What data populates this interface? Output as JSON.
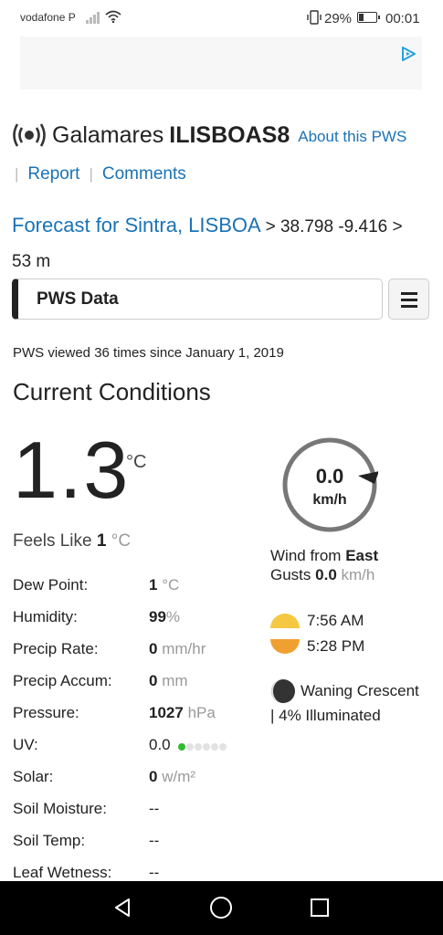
{
  "status_bar": {
    "carrier": "vodafone P",
    "battery_percent": "29%",
    "battery_level": 0.29,
    "time": "00:01"
  },
  "ad": {
    "icon": "adchoices-play-icon"
  },
  "header": {
    "station_name": "Galamares",
    "station_id": "ILISBOAS8",
    "about_link": "About this PWS",
    "icon": "broadcast-icon"
  },
  "links": {
    "report": "Report",
    "comments": "Comments",
    "separator": "|"
  },
  "forecast": {
    "link": "Forecast for Sintra, LISBOA",
    "coords": "> 38.798 -9.416 >",
    "elevation": "53 m"
  },
  "pws_bar": {
    "label": "PWS Data",
    "menu_icon": "hamburger-menu-icon"
  },
  "views_text": "PWS viewed 36 times since January 1, 2019",
  "current": {
    "title": "Current Conditions",
    "temperature": "1.3",
    "temp_unit": "°C",
    "feels_like_label": "Feels Like",
    "feels_like_value": "1",
    "feels_like_unit": "°C"
  },
  "conditions": [
    {
      "label": "Dew Point:",
      "value": "1",
      "unit": "°C"
    },
    {
      "label": "Humidity:",
      "value": "99",
      "unit": "%"
    },
    {
      "label": "Precip Rate:",
      "value": "0",
      "unit": "mm/hr"
    },
    {
      "label": "Precip Accum:",
      "value": "0",
      "unit": "mm"
    },
    {
      "label": "Pressure:",
      "value": "1027",
      "unit": "hPa"
    },
    {
      "label": "UV:",
      "value": "0.0",
      "unit": ""
    },
    {
      "label": "Solar:",
      "value": "0",
      "unit": "w/m²"
    },
    {
      "label": "Soil Moisture:",
      "value": "--",
      "unit": ""
    },
    {
      "label": "Soil Temp:",
      "value": "--",
      "unit": ""
    },
    {
      "label": "Leaf Wetness:",
      "value": "--",
      "unit": ""
    }
  ],
  "uv_level_dots": {
    "on": 1,
    "total": 6
  },
  "wind": {
    "speed": "0.0",
    "unit": "km/h",
    "from_label": "Wind from",
    "from_dir": "East",
    "gusts_label": "Gusts",
    "gusts_value": "0.0",
    "gusts_unit": "km/h"
  },
  "sun": {
    "sunrise": "7:56 AM",
    "sunset": "5:28 PM",
    "sunrise_icon": "sunrise-icon",
    "sunset_icon": "sunset-icon"
  },
  "moon": {
    "phase": "Waning Crescent",
    "illumination": "| 4% Illuminated",
    "icon": "moon-icon"
  },
  "colors": {
    "link": "#1a73b6",
    "sunrise": "#f5c842",
    "sunset": "#f0a030",
    "uv_on": "#2ebc2e"
  }
}
